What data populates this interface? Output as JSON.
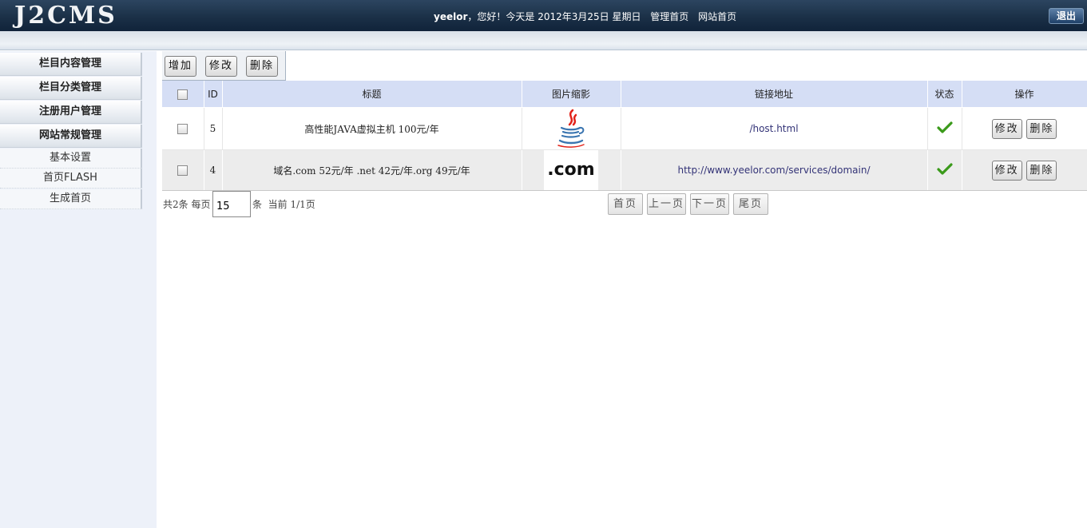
{
  "header": {
    "logo": "J2CMS",
    "username": "yeelor",
    "greeting": "，您好！今天是 2012年3月25日 星期日",
    "links": [
      "管理首页",
      "网站首页"
    ],
    "logout_label": "退出"
  },
  "sidebar": {
    "sections": [
      "栏目内容管理",
      "栏目分类管理",
      "注册用户管理",
      "网站常规管理"
    ],
    "subitems": [
      "基本设置",
      "首页FLASH",
      "生成首页"
    ]
  },
  "toolbar": {
    "add_label": "增加",
    "edit_label": "修改",
    "delete_label": "删除"
  },
  "table": {
    "headers": [
      "ID",
      "标题",
      "图片缩影",
      "链接地址",
      "状态",
      "操作"
    ],
    "rows": [
      {
        "id": "5",
        "title": "高性能JAVA虚拟主机 100元/年",
        "image_icon": "java-logo-icon",
        "link": "/host.html",
        "status_icon": "check-icon",
        "edit": "修改",
        "delete": "删除"
      },
      {
        "id": "4",
        "title": "域名.com 52元/年 .net 42元/年.org 49元/年",
        "image_icon": "dotcom-logo-icon",
        "image_text": ".com",
        "link": "http://www.yeelor.com/services/domain/",
        "status_icon": "check-icon",
        "edit": "修改",
        "delete": "删除"
      }
    ]
  },
  "pager": {
    "total": "共2条",
    "per_page_label": "每页",
    "per_page_value": "15",
    "unit": "条",
    "current": "当前 1/1页",
    "first": "首页",
    "prev": "上一页",
    "next": "下一页",
    "last": "尾页"
  },
  "colors": {
    "header_bg": "#1b3047",
    "table_header_bg": "#d5def5",
    "status_check": "#3a9a1a",
    "link_text": "#333377"
  }
}
